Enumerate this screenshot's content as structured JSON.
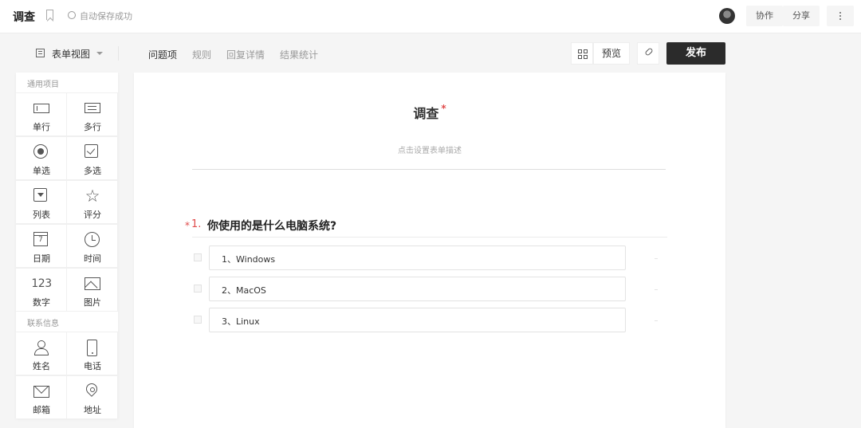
{
  "topbar": {
    "title": "调查",
    "save_status": "自动保存成功",
    "collab_label": "协作",
    "share_label": "分享"
  },
  "toolbar": {
    "view_label": "表单视图",
    "tabs": [
      {
        "label": "问题项",
        "active": true
      },
      {
        "label": "规则",
        "active": false
      },
      {
        "label": "回复详情",
        "active": false
      },
      {
        "label": "结果统计",
        "active": false
      }
    ],
    "preview_label": "预览",
    "publish_label": "发布"
  },
  "palette": {
    "common_heading": "通用项目",
    "common_items": [
      {
        "label": "单行",
        "icon": "single-line-icon"
      },
      {
        "label": "多行",
        "icon": "multi-line-icon"
      },
      {
        "label": "单选",
        "icon": "radio-icon"
      },
      {
        "label": "多选",
        "icon": "checkbox-icon"
      },
      {
        "label": "列表",
        "icon": "dropdown-list-icon"
      },
      {
        "label": "评分",
        "icon": "star-icon"
      },
      {
        "label": "日期",
        "icon": "calendar-icon"
      },
      {
        "label": "时间",
        "icon": "clock-icon"
      },
      {
        "label": "数字",
        "icon": "number-icon",
        "glyph": "123"
      },
      {
        "label": "图片",
        "icon": "image-icon"
      }
    ],
    "contact_heading": "联系信息",
    "contact_items": [
      {
        "label": "姓名",
        "icon": "person-icon"
      },
      {
        "label": "电话",
        "icon": "phone-icon"
      },
      {
        "label": "邮箱",
        "icon": "mail-icon"
      },
      {
        "label": "地址",
        "icon": "location-icon"
      }
    ]
  },
  "form": {
    "title": "调查",
    "required_mark": "*",
    "description_placeholder": "点击设置表单描述",
    "question": {
      "required_mark": "*",
      "number": "1.",
      "text": "你使用的是什么电脑系统?",
      "options": [
        "1、Windows",
        "2、MacOS",
        "3、Linux"
      ]
    }
  },
  "colors": {
    "publish_bg": "#2b2b2b",
    "required": "#e04b4b",
    "page_bg": "#f5f5f5"
  }
}
